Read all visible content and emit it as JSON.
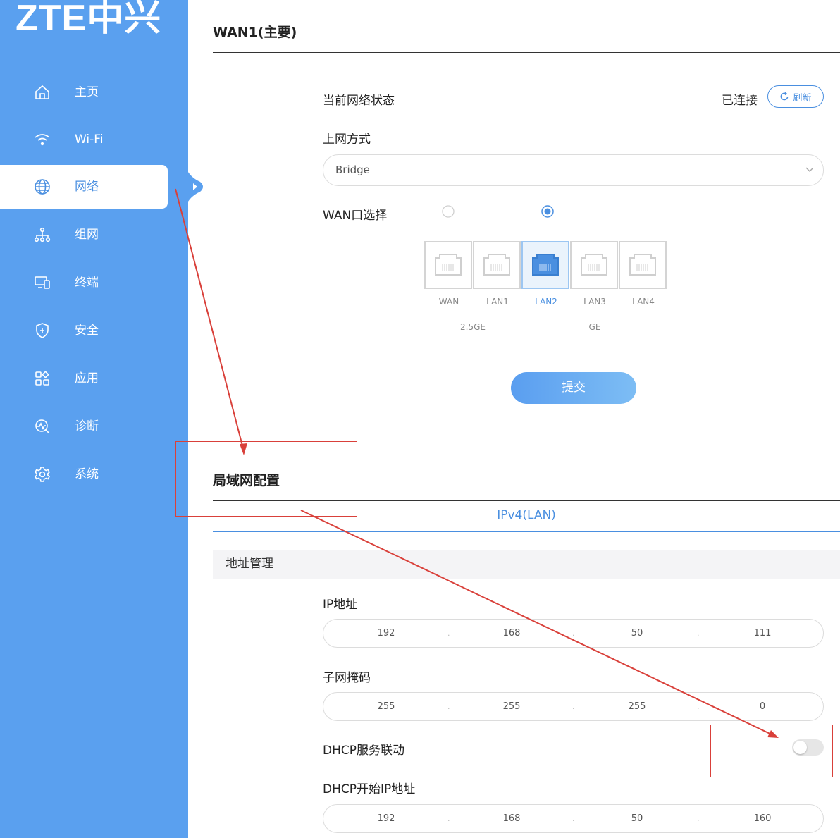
{
  "brand": {
    "logo_text": "ZTE中兴"
  },
  "sidebar": {
    "items": [
      {
        "label": "主页",
        "icon": "home-icon"
      },
      {
        "label": "Wi-Fi",
        "icon": "wifi-icon"
      },
      {
        "label": "网络",
        "icon": "globe-icon",
        "active": true
      },
      {
        "label": "组网",
        "icon": "mesh-icon"
      },
      {
        "label": "终端",
        "icon": "devices-icon"
      },
      {
        "label": "安全",
        "icon": "shield-icon"
      },
      {
        "label": "应用",
        "icon": "apps-icon"
      },
      {
        "label": "诊断",
        "icon": "diagnose-icon"
      },
      {
        "label": "系统",
        "icon": "gear-icon"
      }
    ]
  },
  "wan": {
    "title": "WAN1(主要)",
    "status_label": "当前网络状态",
    "status_value": "已连接",
    "refresh_label": "刷新",
    "mode_label": "上网方式",
    "mode_value": "Bridge",
    "port_select_label": "WAN口选择",
    "ports": [
      "WAN",
      "LAN1",
      "LAN2",
      "LAN3",
      "LAN4"
    ],
    "selected_port": "LAN2",
    "speed_groups": [
      "2.5GE",
      "GE"
    ],
    "submit_label": "提交"
  },
  "lan": {
    "title": "局域网配置",
    "tab": "IPv4(LAN)",
    "section": "地址管理",
    "ip_label": "IP地址",
    "ip_value": [
      "192",
      "168",
      "50",
      "111"
    ],
    "mask_label": "子网掩码",
    "mask_value": [
      "255",
      "255",
      "255",
      "0"
    ],
    "dhcp_label": "DHCP服务联动",
    "dhcp_enabled": false,
    "dhcp_start_label": "DHCP开始IP地址",
    "dhcp_start_value": [
      "192",
      "168",
      "50",
      "160"
    ]
  },
  "colors": {
    "sidebar": "#5aa0ef",
    "accent": "#4a8fe0",
    "annotation": "#d9403a"
  }
}
